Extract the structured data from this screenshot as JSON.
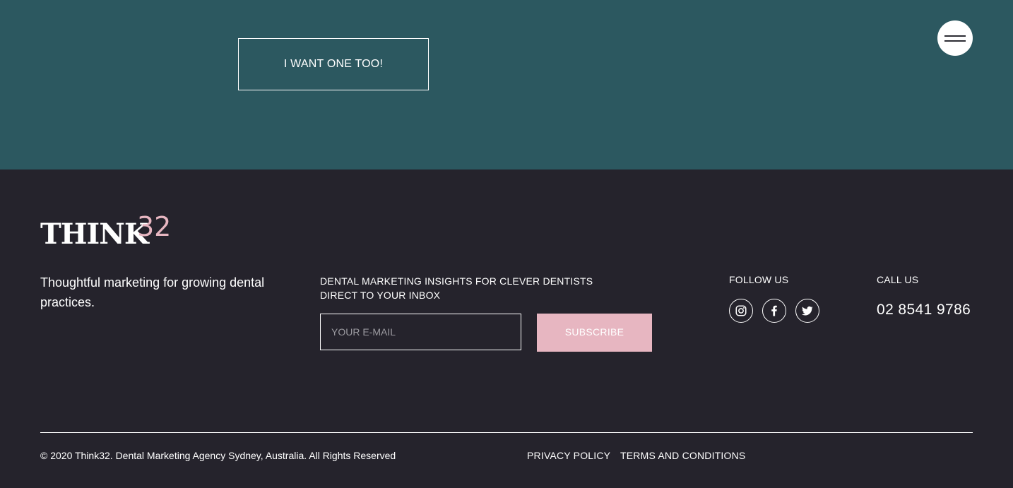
{
  "hero": {
    "cta_label": "I WANT ONE TOO!",
    "background_color": "#2c5860"
  },
  "footer": {
    "logo": {
      "word": "THINK",
      "superscript": "32",
      "accent_color": "#e7b6c1"
    },
    "tagline": "Thoughtful marketing for growing dental practices.",
    "newsletter": {
      "title_line1": "DENTAL MARKETING INSIGHTS FOR CLEVER DENTISTS",
      "title_line2": "DIRECT TO YOUR INBOX",
      "email_placeholder": "YOUR E-MAIL",
      "email_value": "",
      "subscribe_label": "SUBSCRIBE",
      "button_color": "#e7b6c1"
    },
    "follow": {
      "label": "FOLLOW US",
      "icons": [
        "instagram-icon",
        "facebook-icon",
        "twitter-icon"
      ]
    },
    "call": {
      "label": "CALL US",
      "phone": "02 8541 9786"
    },
    "copyright": "© 2020 Think32. Dental Marketing Agency Sydney, Australia. All Rights Reserved",
    "links": {
      "privacy": "PRIVACY POLICY",
      "terms": "TERMS AND CONDITIONS"
    },
    "background_color": "#25232c"
  }
}
